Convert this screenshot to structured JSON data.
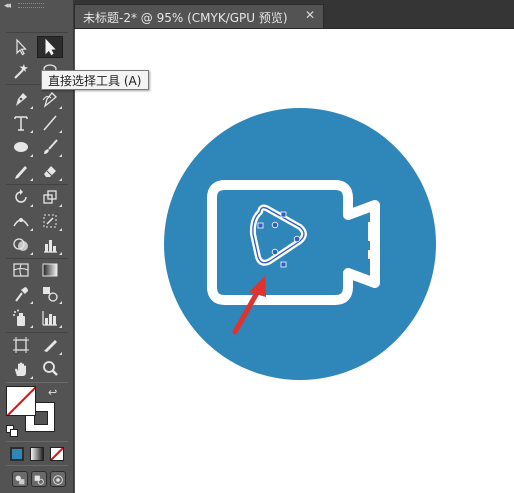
{
  "document": {
    "tab_title": "未标题-2* @ 95% (CMYK/GPU 预览)",
    "close_glyph": "✕"
  },
  "tooltip": {
    "text": "直接选择工具 (A)"
  },
  "toolbar": {
    "collapse_glyph": "◂◂",
    "tools": [
      {
        "name": "selection-tool",
        "icon": "black-arrow-icon"
      },
      {
        "name": "direct-selection-tool",
        "icon": "white-arrow-icon",
        "active": true
      },
      {
        "name": "magic-wand-tool",
        "icon": "magic-wand-icon"
      },
      {
        "name": "lasso-tool",
        "icon": "lasso-icon"
      },
      {
        "name": "pen-tool",
        "icon": "pen-icon"
      },
      {
        "name": "curvature-tool",
        "icon": "curvature-pen-icon"
      },
      {
        "name": "type-tool",
        "icon": "type-icon"
      },
      {
        "name": "line-segment-tool",
        "icon": "line-icon"
      },
      {
        "name": "ellipse-tool",
        "icon": "ellipse-icon"
      },
      {
        "name": "paintbrush-tool",
        "icon": "paintbrush-icon"
      },
      {
        "name": "pencil-tool",
        "icon": "pencil-icon"
      },
      {
        "name": "eraser-tool",
        "icon": "eraser-icon"
      },
      {
        "name": "rotate-tool",
        "icon": "rotate-icon"
      },
      {
        "name": "scale-tool",
        "icon": "scale-icon"
      },
      {
        "name": "width-tool",
        "icon": "width-icon"
      },
      {
        "name": "free-transform-tool",
        "icon": "free-transform-icon"
      },
      {
        "name": "shape-builder-tool",
        "icon": "shape-builder-icon"
      },
      {
        "name": "column-graph-tool",
        "icon": "graph-icon"
      },
      {
        "name": "mesh-tool",
        "icon": "mesh-icon"
      },
      {
        "name": "gradient-tool",
        "icon": "gradient-icon"
      },
      {
        "name": "eyedropper-tool",
        "icon": "eyedropper-icon"
      },
      {
        "name": "blend-tool",
        "icon": "blend-icon"
      },
      {
        "name": "symbol-sprayer-tool",
        "icon": "symbol-sprayer-icon"
      },
      {
        "name": "bar-graph-tool",
        "icon": "bar-chart-icon"
      },
      {
        "name": "artboard-tool",
        "icon": "artboard-icon"
      },
      {
        "name": "slice-tool",
        "icon": "slice-icon"
      },
      {
        "name": "hand-tool",
        "icon": "hand-icon"
      },
      {
        "name": "zoom-tool",
        "icon": "zoom-icon"
      }
    ]
  },
  "colors": {
    "icon_circle": "#2e86b9",
    "icon_stroke": "#ffffff",
    "arrow": "#e0322e",
    "selection_path": "#2f5fbf",
    "fill": "#ffffff",
    "stroke": "#ffffff",
    "none_slash": "#e30b0b",
    "color_mode": "#2e86b9"
  },
  "drawing_modes": [
    "color-mode",
    "gradient-mode",
    "none-mode"
  ],
  "screen_modes": [
    "draw-normal",
    "draw-behind",
    "draw-inside"
  ]
}
